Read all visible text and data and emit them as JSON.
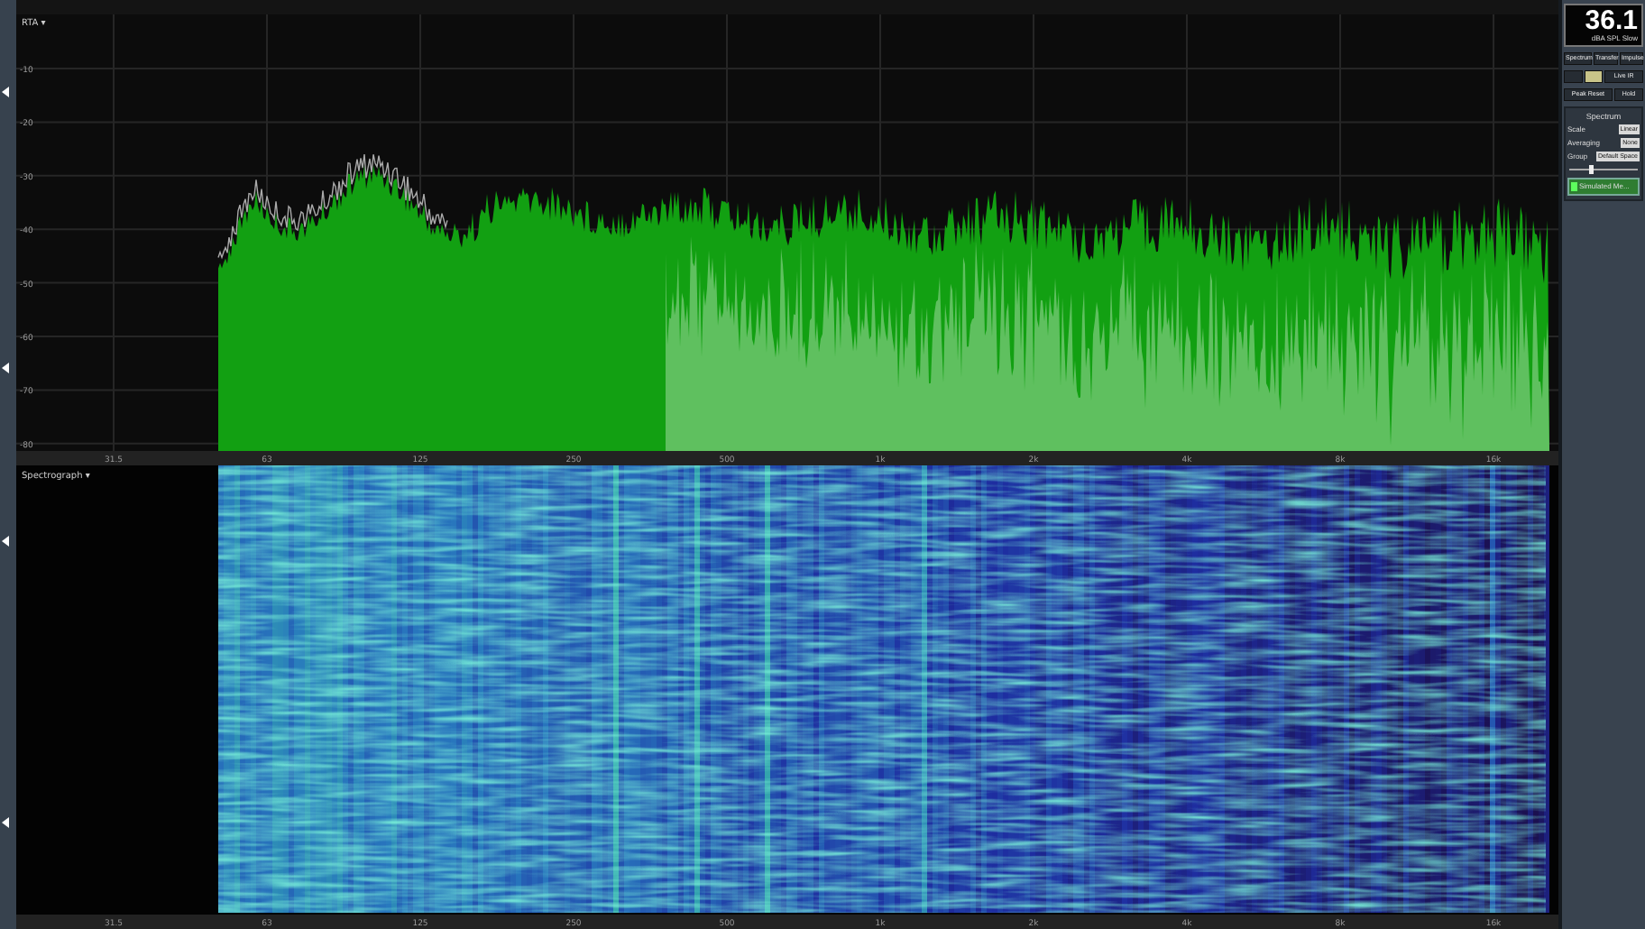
{
  "rta": {
    "title": "RTA ▾",
    "y_labels": [
      "-10",
      "-20",
      "-30",
      "-40",
      "-50",
      "-60",
      "-70",
      "-80"
    ],
    "x_labels": [
      "31.5",
      "63",
      "125",
      "250",
      "500",
      "1k",
      "2k",
      "4k",
      "8k",
      "16k"
    ]
  },
  "spectrograph": {
    "title": "Spectrograph ▾",
    "x_labels": [
      "31.5",
      "63",
      "125",
      "250",
      "500",
      "1k",
      "2k",
      "4k",
      "8k",
      "16k"
    ]
  },
  "meter": {
    "reading": "36.1",
    "unit": "dBA SPL Slow"
  },
  "tabs": [
    {
      "label": "Spectrum"
    },
    {
      "label": "Transfer"
    },
    {
      "label": "Impulse"
    }
  ],
  "toggles": [
    {
      "selected": false
    },
    {
      "selected": true
    }
  ],
  "live_ir_button": "Live IR",
  "peak_reset_button": "Peak Reset",
  "hold_button": "Hold",
  "spectrum_panel": {
    "title": "Spectrum",
    "settings": [
      {
        "label": "Scale",
        "value": "Linear"
      },
      {
        "label": "Averaging",
        "value": "None"
      }
    ],
    "group": {
      "label": "Group",
      "value": "Default Space"
    },
    "slider": {
      "level": 0.3
    },
    "source": {
      "label": "Simulated Me...",
      "on": true
    }
  }
}
